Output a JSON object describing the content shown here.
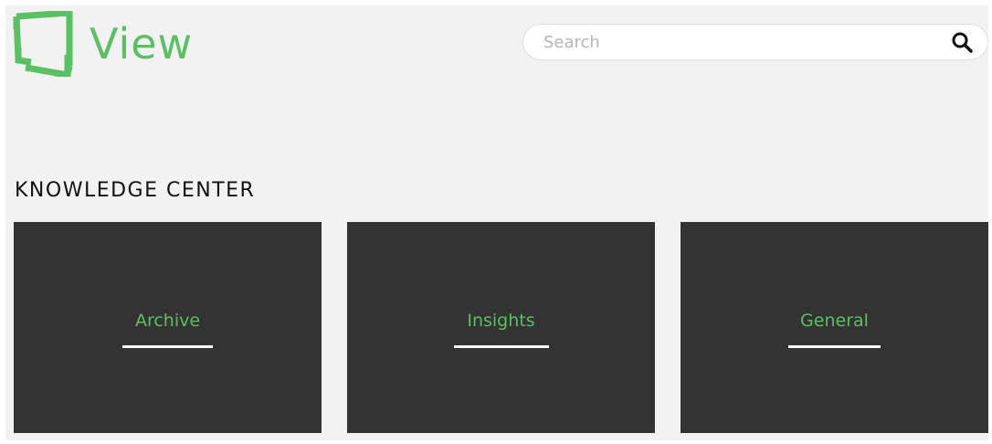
{
  "brand": {
    "name": "View",
    "logo_icon": "view-frame-logo-icon",
    "color": "#5bbf63"
  },
  "search": {
    "placeholder": "Search",
    "value": "",
    "icon": "search-icon"
  },
  "section": {
    "title": "KNOWLEDGE CENTER"
  },
  "cards": [
    {
      "label": "Archive"
    },
    {
      "label": "Insights"
    },
    {
      "label": "General"
    }
  ],
  "colors": {
    "background": "#f2f2f2",
    "card_background": "#333333",
    "accent": "#5bbf63",
    "underline": "#ffffff"
  }
}
